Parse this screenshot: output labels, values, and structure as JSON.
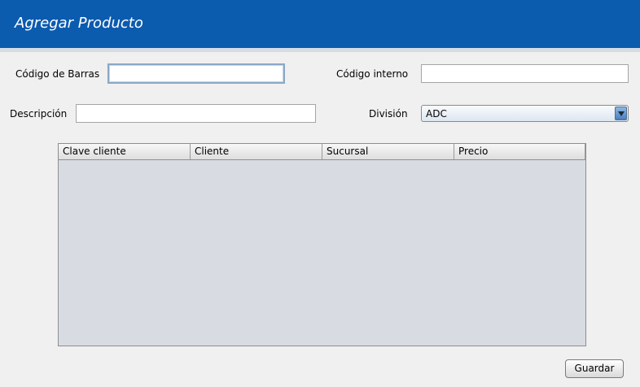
{
  "header": {
    "title": "Agregar Producto"
  },
  "form": {
    "barcode_label": "Código de Barras",
    "barcode_value": "",
    "internal_code_label": "Código interno",
    "internal_code_value": "",
    "description_label": "Descripción",
    "description_value": "",
    "division_label": "División",
    "division_selected": "ADC"
  },
  "table": {
    "columns": [
      "Clave cliente",
      "Cliente",
      "Sucursal",
      "Precio"
    ],
    "rows": []
  },
  "actions": {
    "save_label": "Guardar"
  },
  "colors": {
    "header_bg": "#0b5baf",
    "table_bg": "#d8dbe2",
    "window_bg": "#f0f0f0"
  }
}
